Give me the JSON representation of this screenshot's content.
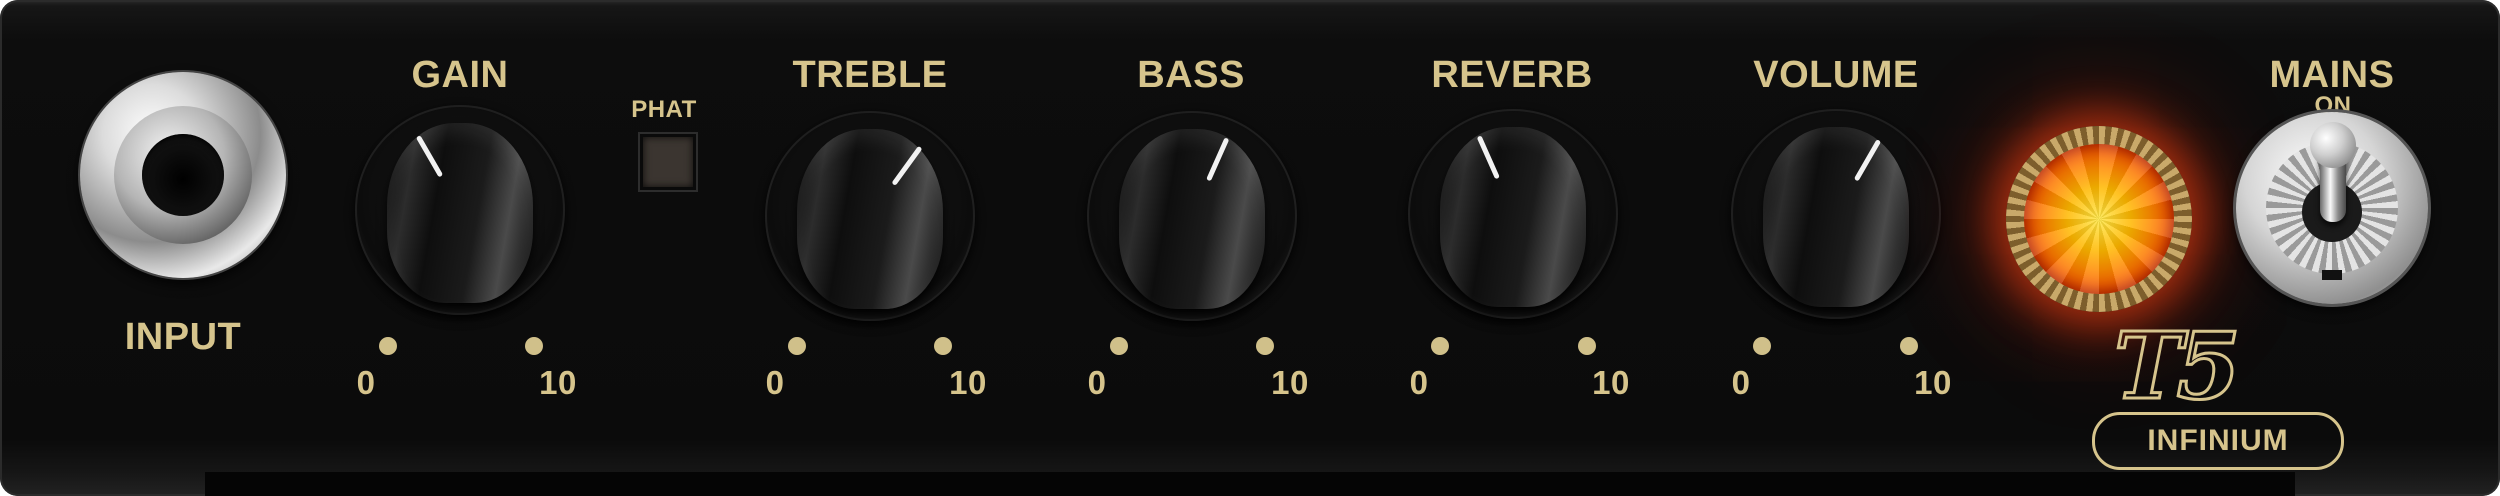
{
  "panel": {
    "model_logo": "T5",
    "model_badge": "INFINIUM"
  },
  "input": {
    "label": "INPUT"
  },
  "phat": {
    "label": "PHAT"
  },
  "knobs": [
    {
      "label": "GAIN",
      "min": "0",
      "max": "10",
      "level": 0.4
    },
    {
      "label": "TREBLE",
      "min": "0",
      "max": "10",
      "level": 0.62
    },
    {
      "label": "BASS",
      "min": "0",
      "max": "10",
      "level": 0.58
    },
    {
      "label": "REVERB",
      "min": "0",
      "max": "10",
      "level": 0.42
    },
    {
      "label": "VOLUME",
      "min": "0",
      "max": "10",
      "level": 0.6
    }
  ],
  "mains": {
    "label": "MAINS",
    "state_label": "ON"
  },
  "colors": {
    "accent": "#d6c48c",
    "panel": "#0b0b0b",
    "lamp": "#ff6a00"
  },
  "icons": {
    "input": "input-jack-icon",
    "lamp": "pilot-lamp-icon",
    "mains": "toggle-switch-icon"
  }
}
